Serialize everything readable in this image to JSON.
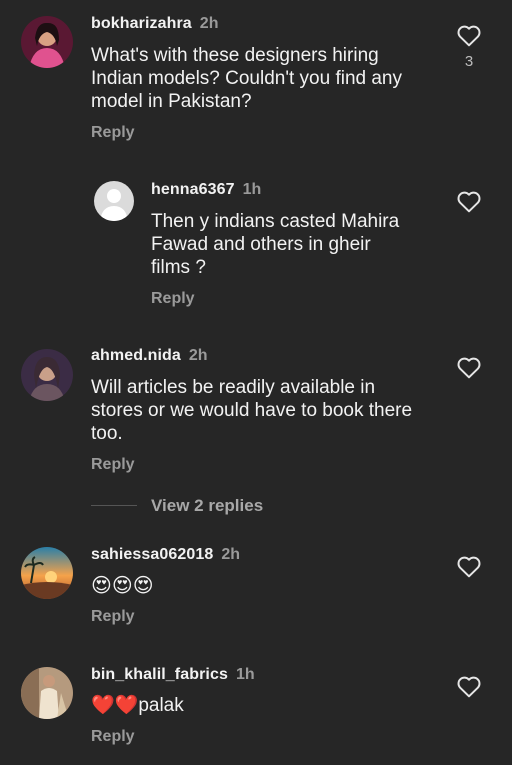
{
  "comments": [
    {
      "username": "bokharizahra",
      "time": "2h",
      "text": "What's with these designers hiring\nIndian models? Couldn't you find any\nmodel in Pakistan?",
      "reply_label": "Reply",
      "like_count": "3",
      "avatar_colors": [
        "#6b1a3c",
        "#d94a83"
      ]
    },
    {
      "username": "henna6367",
      "time": "1h",
      "text": "Then y indians casted Mahira\nFawad and others in gheir\nfilms ?",
      "reply_label": "Reply",
      "avatar_colors": [
        "#e6e6e6",
        "#ffffff"
      ]
    },
    {
      "username": "ahmed.nida",
      "time": "2h",
      "text": "Will articles be readily available in\nstores or we would have to book there\ntoo.",
      "reply_label": "Reply",
      "avatar_colors": [
        "#3a2a44",
        "#c9a58c"
      ]
    },
    {
      "username": "sahiessa062018",
      "time": "2h",
      "text": "😍😍😍",
      "reply_label": "Reply",
      "avatar_colors": [
        "#1f6a8a",
        "#f0893a"
      ]
    },
    {
      "username": "bin_khalil_fabrics",
      "time": "1h",
      "text": "❤️❤️palak",
      "reply_label": "Reply",
      "avatar_colors": [
        "#a58b6f",
        "#e8d7c0"
      ]
    }
  ],
  "view_replies": "View 2 replies"
}
